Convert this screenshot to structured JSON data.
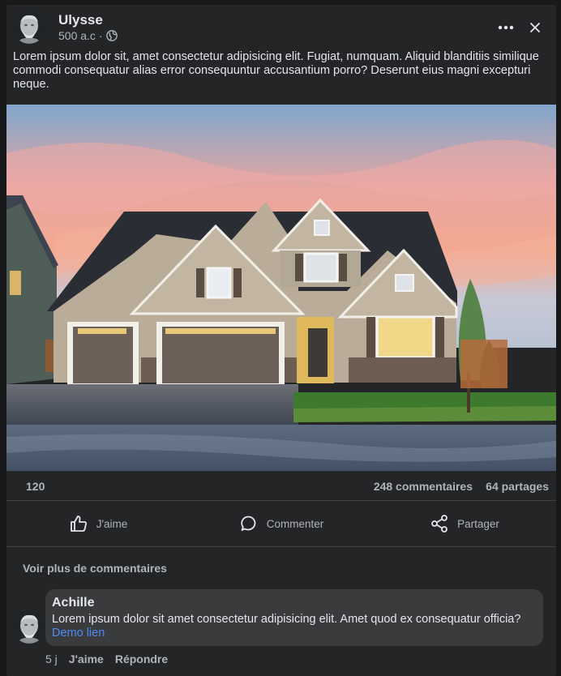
{
  "post": {
    "author": "Ulysse",
    "time": "500 a.c",
    "separator": "·",
    "text": "Lorem ipsum dolor sit, amet consectetur adipisicing elit. Fugiat, numquam. Aliquid blanditiis similique commodi consequatur alias error consequuntur accusantium porro? Deserunt eius magni excepturi neque.",
    "privacy_icon": "globe-icon",
    "image_subject": "house"
  },
  "stats": {
    "reactions": "120",
    "comments": "248 commentaires",
    "shares": "64 partages"
  },
  "actions": {
    "like": "J'aime",
    "comment": "Commenter",
    "share": "Partager"
  },
  "comments_section": {
    "more_label": "Voir plus de commentaires",
    "comment": {
      "author": "Achille",
      "text": "Lorem ipsum dolor sit amet consectetur adipisicing elit. Amet quod ex consequatur officia?",
      "link": "Demo lien",
      "time": "5 j",
      "like": "J'aime",
      "reply": "Répondre"
    }
  },
  "colors": {
    "background": "#18191a",
    "card": "#242526",
    "bubble": "#3a3b3c",
    "link": "#4d8bf5",
    "secondary_text": "#b0b3b8"
  }
}
